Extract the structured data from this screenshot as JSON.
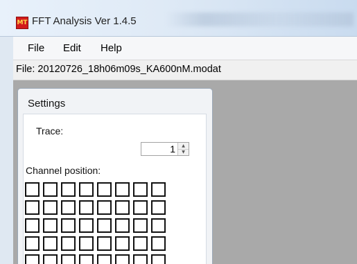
{
  "window": {
    "title": "FFT Analysis Ver 1.4.5",
    "icon": "mt-app-icon"
  },
  "menu": [
    "File",
    "Edit",
    "Help"
  ],
  "file": {
    "label": "File: 20120726_18h06m09s_KA600nM.modat"
  },
  "settings": {
    "title": "Settings",
    "trace_label": "Trace:",
    "trace_value": "1",
    "channel_label": "Channel position:",
    "channel_grid": {
      "columns": 8,
      "visible_rows": 5
    }
  },
  "colors": {
    "app_icon_red": "#d21b1b",
    "content_background": "#a9a9a9"
  }
}
